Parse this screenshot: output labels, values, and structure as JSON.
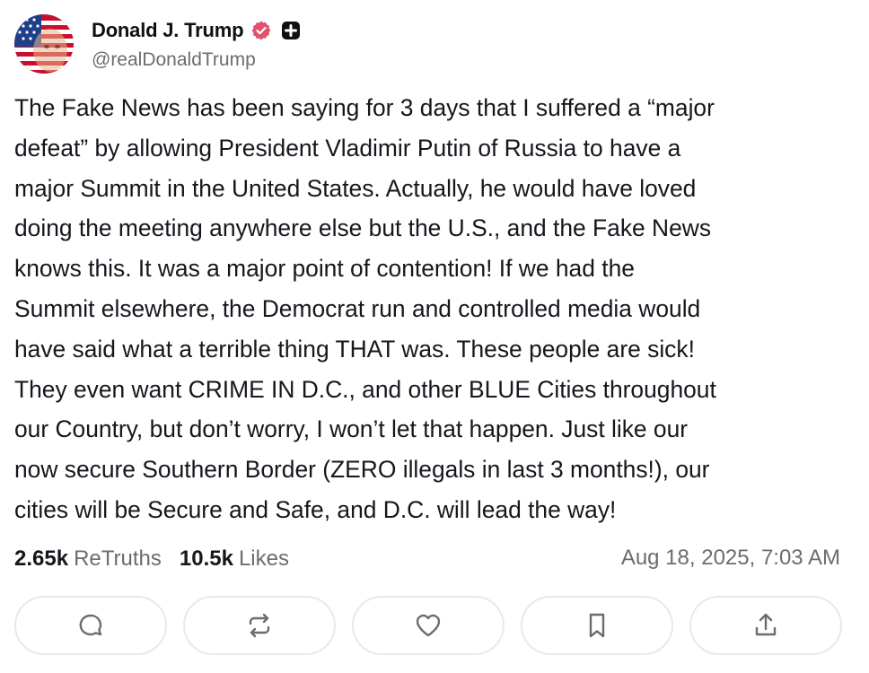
{
  "author": {
    "display_name": "Donald J. Trump",
    "handle": "@realDonaldTrump",
    "verified_icon": "verified-badge-icon",
    "verified_color": "#e0526e",
    "plus_icon": "plus-badge-icon"
  },
  "post": {
    "lines": [
      "The Fake News has been saying for 3 days that I suffered a “major",
      "defeat” by allowing President Vladimir Putin of Russia to have a",
      "major Summit in the United States. Actually, he would have loved",
      "doing the meeting anywhere else but the U.S., and the Fake News",
      "knows this. It was a major point of contention! If we had the",
      "Summit elsewhere, the Democrat run and controlled media would",
      "have said what a terrible thing THAT was. These people are sick!",
      "They even want CRIME IN D.C., and other BLUE Cities throughout",
      "our Country, but don’t worry, I won’t let that happen. Just like our",
      "now secure Southern Border (ZERO illegals in last 3 months!), our",
      "cities will be Secure and Safe, and D.C. will lead the way!"
    ]
  },
  "stats": {
    "retruths_count": "2.65k",
    "retruths_label": "ReTruths",
    "likes_count": "10.5k",
    "likes_label": "Likes",
    "timestamp": "Aug 18, 2025, 7:03 AM"
  },
  "actions": {
    "icons": [
      "reply-icon",
      "retruth-icon",
      "like-icon",
      "bookmark-icon",
      "share-icon"
    ],
    "border_color": "#e8e8ee",
    "icon_color": "#6b6b73"
  }
}
